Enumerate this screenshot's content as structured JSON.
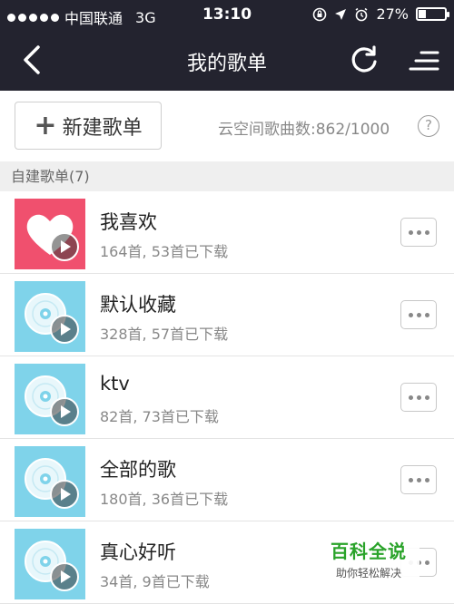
{
  "status_bar": {
    "carrier": "中国联通",
    "network": "3G",
    "time": "13:10",
    "battery_text": "27%",
    "battery_level": 0.27
  },
  "nav": {
    "title": "我的歌单",
    "back_icon": "chevron-left-icon",
    "refresh_icon": "refresh-icon",
    "menu_icon": "menu-icon"
  },
  "toolbar": {
    "new_playlist_label": "新建歌单",
    "cloud_count": "云空间歌曲数:862/1000",
    "help_label": "?"
  },
  "section": {
    "title": "自建歌单(7)"
  },
  "playlists": [
    {
      "name": "我喜欢",
      "meta": "164首, 53首已下载",
      "cover": "heart-cover"
    },
    {
      "name": "默认收藏",
      "meta": "328首, 57首已下载",
      "cover": "disc-cover"
    },
    {
      "name": "ktv",
      "meta": "82首, 73首已下载",
      "cover": "disc-cover"
    },
    {
      "name": "全部的歌",
      "meta": "180首, 36首已下载",
      "cover": "disc-cover"
    },
    {
      "name": "真心好听",
      "meta": "34首, 9首已下载",
      "cover": "disc-cover"
    }
  ],
  "watermark": {
    "title": "百科全说",
    "subtitle": "助你轻松解决"
  },
  "colors": {
    "nav_bg": "#23232f",
    "heart_bg": "#f0506e",
    "disc_bg": "#7fd3ea",
    "watermark_green": "#2aa32a"
  }
}
